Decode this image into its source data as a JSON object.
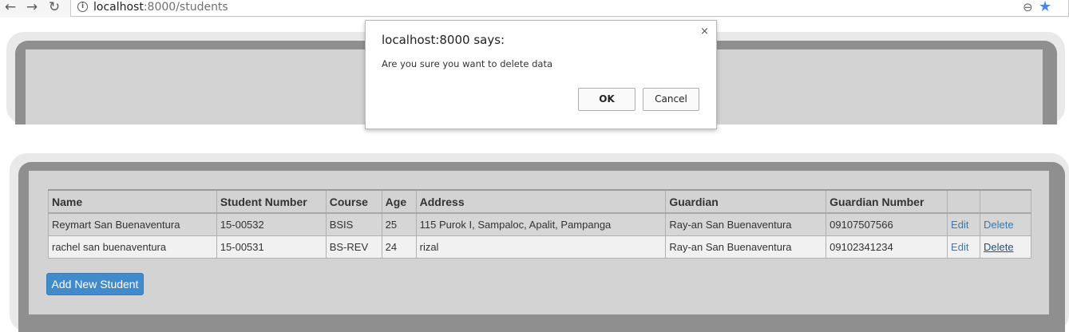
{
  "browser": {
    "back_icon": "arrow-left-icon",
    "forward_icon": "arrow-right-icon",
    "reload_icon": "reload-icon",
    "url_host": "localhost",
    "url_rest": ":8000/students"
  },
  "table": {
    "headers": [
      "Name",
      "Student Number",
      "Course",
      "Age",
      "Address",
      "Guardian",
      "Guardian Number",
      "",
      ""
    ],
    "rows": [
      {
        "name": "Reymart San Buenaventura",
        "student_number": "15-00532",
        "course": "BSIS",
        "age": "25",
        "address": "115 Purok I, Sampaloc, Apalit, Pampanga",
        "guardian": "Ray-an San Buenaventura",
        "guardian_number": "09107507566",
        "edit": "Edit",
        "delete": "Delete"
      },
      {
        "name": "rachel san buenaventura",
        "student_number": "15-00531",
        "course": "BS-REV",
        "age": "24",
        "address": "rizal",
        "guardian": "Ray-an San Buenaventura",
        "guardian_number": "09102341234",
        "edit": "Edit",
        "delete": "Delete"
      }
    ]
  },
  "add_button": "Add New Student",
  "dialog": {
    "title": "localhost:8000 says:",
    "message": "Are you sure you want to delete data",
    "ok": "OK",
    "cancel": "Cancel",
    "close": "×"
  },
  "colors": {
    "accent": "#428bca",
    "link": "#337ab7",
    "panel": "#d3d3d3",
    "frame": "#8f8f8f"
  }
}
